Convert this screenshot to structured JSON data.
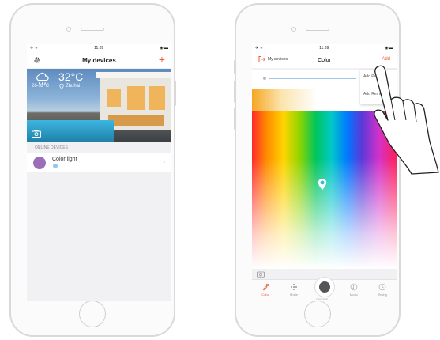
{
  "left_phone": {
    "status_time": "11:39",
    "nav_title": "My devices",
    "weather": {
      "temperature": "32°C",
      "range": "26-32°C",
      "city": "Zhuhai"
    },
    "section_header": "ONLINE DEVICES",
    "devices": [
      {
        "name": "Color light"
      }
    ]
  },
  "right_phone": {
    "status_time": "11:39",
    "back_label": "My devices",
    "nav_title": "Color",
    "add_label": "Add",
    "menu_items": [
      "Add Panels",
      "Add Remote"
    ],
    "tabs": [
      {
        "label": "Color",
        "icon": "color-icon",
        "active": true
      },
      {
        "label": "Mode",
        "icon": "mode-icon",
        "active": false
      },
      {
        "label": "ON/OFF",
        "icon": "power-icon",
        "active": false
      },
      {
        "label": "Music",
        "icon": "music-icon",
        "active": false
      },
      {
        "label": "Timing",
        "icon": "clock-icon",
        "active": false
      }
    ]
  },
  "colors": {
    "accent": "#f05a3c",
    "device_avatar": "#9b6fb7",
    "device_dot": "#8fcaf0"
  }
}
